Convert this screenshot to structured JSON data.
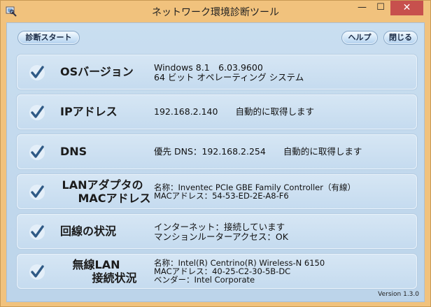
{
  "window": {
    "title": "ネットワーク環境診断ツール",
    "minimize_glyph": "—",
    "maximize_glyph": "☐",
    "close_glyph": "✕"
  },
  "toolbar": {
    "start_label": "診断スタート",
    "help_label": "ヘルプ",
    "close_label": "閉じる"
  },
  "rows": [
    {
      "label_1": "OSバージョン",
      "label_2": "",
      "details": [
        "Windows 8.1　6.03.9600",
        "64 ビット オペレーティング システム",
        ""
      ]
    },
    {
      "label_1": "IPアドレス",
      "label_2": "",
      "details": [
        "192.168.2.140　　自動的に取得します",
        "",
        ""
      ]
    },
    {
      "label_1": "DNS",
      "label_2": "",
      "details": [
        "優先 DNS：192.168.2.254　　自動的に取得します",
        "",
        ""
      ]
    },
    {
      "label_1": "LANアダプタの",
      "label_2": "MACアドレス",
      "details": [
        "名称：Inventec PCIe GBE Family Controller（有線）",
        "MACアドレス：54-53-ED-2E-A8-F6",
        ""
      ]
    },
    {
      "label_1": "回線の状況",
      "label_2": "",
      "details": [
        "インターネット：接続しています",
        "マンションルーターアクセス：OK",
        ""
      ]
    },
    {
      "label_1": "無線LAN",
      "label_2": "接続状況",
      "details": [
        "名称：Intel(R) Centrino(R) Wireless-N 6150",
        "MACアドレス：40-25-C2-30-5B-DC",
        "ベンダー：Intel Corporate"
      ]
    }
  ],
  "footer": {
    "version": "Version 1.3.0"
  },
  "colors": {
    "title_bar": "#f1c27d",
    "close_button": "#c7504d",
    "panel": "#c9def0",
    "check": "#2f5a86"
  },
  "icons": {
    "row_status": "checkmark-icon",
    "app": "app-icon"
  }
}
